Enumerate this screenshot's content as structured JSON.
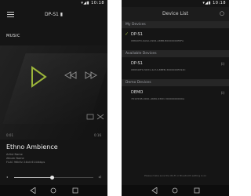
{
  "left_screen": {
    "device_title": "DP-S1",
    "section_label": "MUSIC",
    "player": {
      "time_elapsed": "0:01",
      "time_total": "0:16",
      "track_title": "Ethno Ambience",
      "meta_lines": [
        "Artist Name",
        "Album Name",
        "FLAC 96kHz 24bit 6144kbps"
      ]
    },
    "volume_level": 0.48
  },
  "right_screen": {
    "title": "Device List",
    "sections": [
      {
        "label": "My Devices",
        "devices": [
          {
            "name": "DP-S1",
            "id": "08840F0-9A9A-4964-A8BB-B0000000E8FA",
            "selected": true,
            "info": ""
          }
        ]
      },
      {
        "label": "Available Devices",
        "devices": [
          {
            "name": "DP-S1",
            "id": "089540F0-5631-4A7A-BBEB-3000000E094C",
            "selected": false,
            "info": "(i)"
          }
        ]
      },
      {
        "label": "Demo Devices",
        "devices": [
          {
            "name": "DEMO",
            "id": "7D1059B-9061-4689-930D-30000000000A",
            "selected": false,
            "info": "(i)"
          }
        ]
      }
    ],
    "footer_note": "Please make sure the Wi-Fi or Bluetooth setting is on"
  },
  "icons": {
    "play": "play-icon",
    "prev": "skip-previous-icon",
    "next": "skip-next-icon",
    "repeat": "repeat-icon",
    "shuffle": "shuffle-icon",
    "menu": "hamburger-menu-icon",
    "check": "checkmark-icon",
    "close": "close-icon"
  },
  "colors": {
    "accent": "#9bb53a",
    "background": "#151515"
  }
}
